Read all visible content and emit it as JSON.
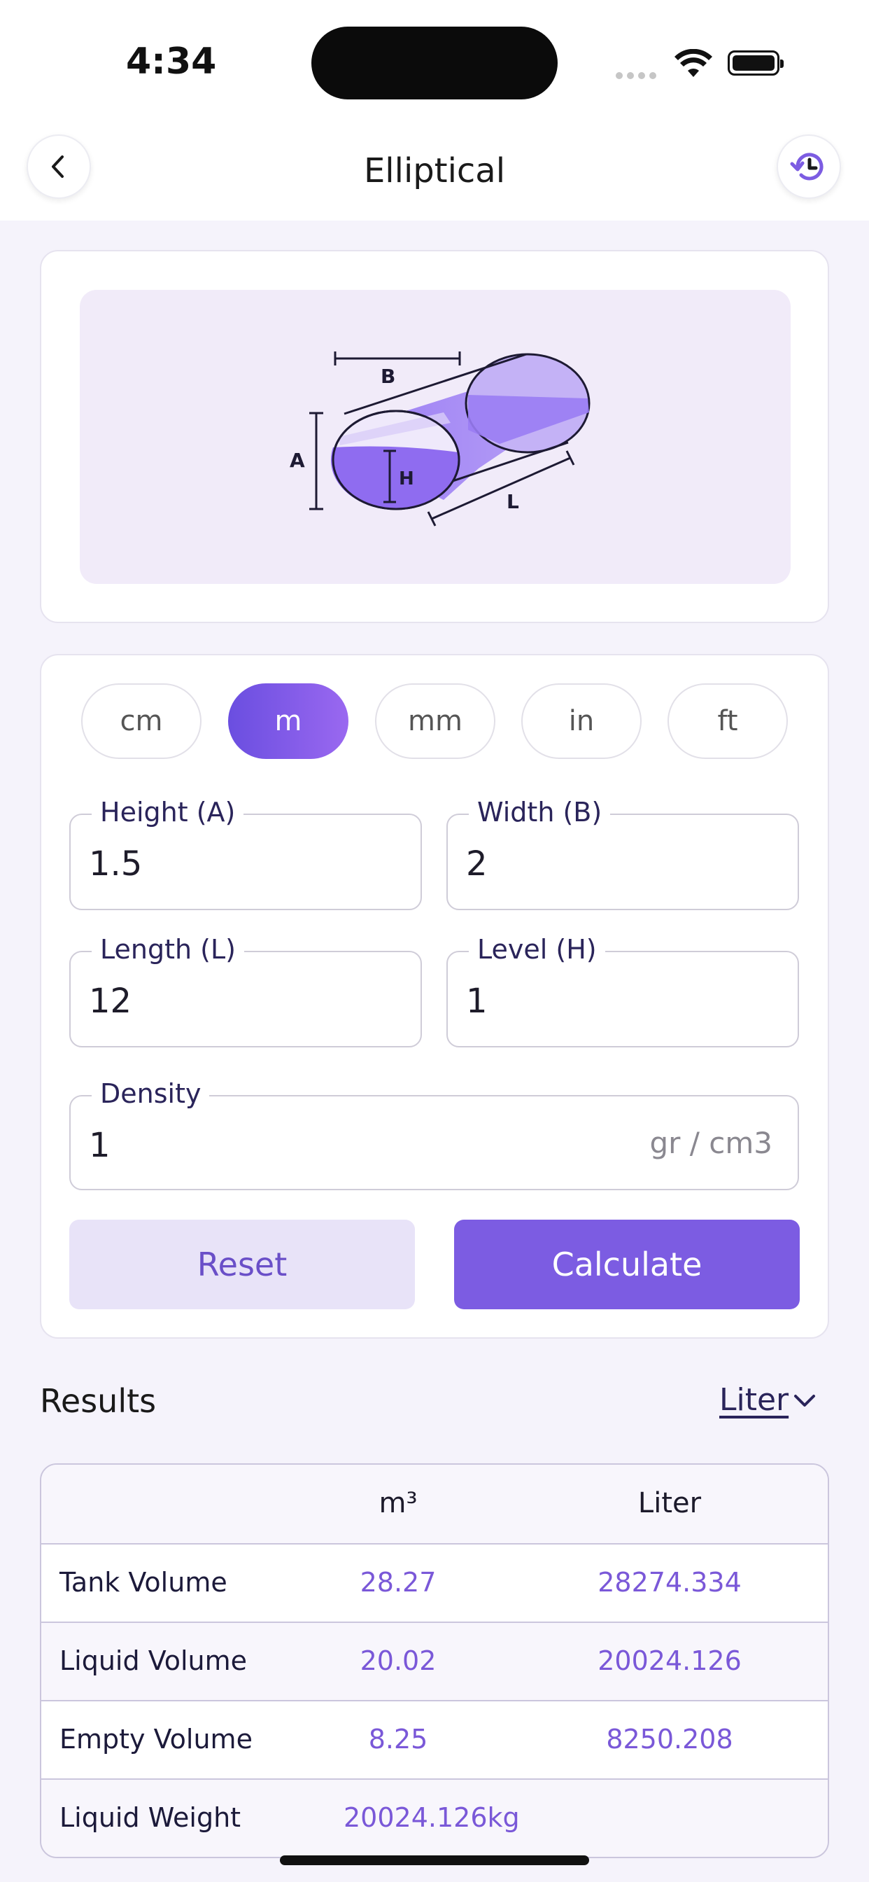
{
  "status_bar": {
    "time": "4:34"
  },
  "header": {
    "title": "Elliptical",
    "back_icon": "chevron-left-icon",
    "history_icon": "history-icon"
  },
  "diagram": {
    "label_a": "A",
    "label_b": "B",
    "label_h": "H",
    "label_l": "L",
    "fill_color": "#8f6cf0"
  },
  "units": {
    "items": [
      "cm",
      "m",
      "mm",
      "in",
      "ft"
    ],
    "selected": "m"
  },
  "fields": {
    "height": {
      "label": "Height (A)",
      "value": "1.5"
    },
    "width": {
      "label": "Width (B)",
      "value": "2"
    },
    "length": {
      "label": "Length (L)",
      "value": "12"
    },
    "level": {
      "label": "Level (H)",
      "value": "1"
    },
    "density": {
      "label": "Density",
      "value": "1",
      "unit": "gr / cm3"
    }
  },
  "buttons": {
    "reset": "Reset",
    "calculate": "Calculate"
  },
  "results": {
    "title": "Results",
    "unit_select": "Liter",
    "columns": [
      "",
      "m³",
      "Liter"
    ],
    "rows": [
      {
        "label": "Tank Volume",
        "m3": "28.27",
        "liter": "28274.334"
      },
      {
        "label": "Liquid Volume",
        "m3": "20.02",
        "liter": "20024.126"
      },
      {
        "label": "Empty Volume",
        "m3": "8.25",
        "liter": "8250.208"
      }
    ],
    "weight": {
      "label": "Liquid Weight",
      "value": "20024.126kg"
    }
  },
  "colors": {
    "accent": "#7c5ce2",
    "accent_light": "#e8e3f8",
    "value_text": "#7a58d8"
  }
}
